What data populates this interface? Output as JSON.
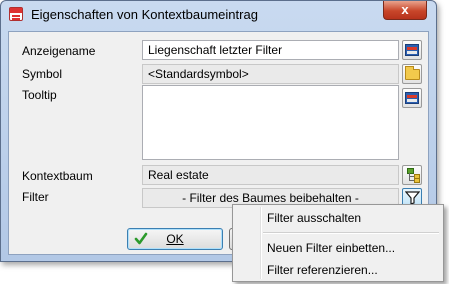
{
  "window": {
    "title": "Eigenschaften von Kontextbaumeintrag",
    "close_label": "x"
  },
  "form": {
    "anzeigename_label": "Anzeigename",
    "anzeigename_value": "Liegenschaft letzter Filter",
    "symbol_label": "Symbol",
    "symbol_value": "<Standardsymbol>",
    "tooltip_label": "Tooltip",
    "tooltip_value": "",
    "kontextbaum_label": "Kontextbaum",
    "kontextbaum_value": "Real estate",
    "filter_label": "Filter",
    "filter_value": "- Filter des Baumes beibehalten -"
  },
  "buttons": {
    "ok_label": "OK"
  },
  "context_menu": {
    "items": [
      "Filter ausschalten",
      "Neuen Filter einbetten...",
      "Filter referenzieren..."
    ]
  },
  "icons": {
    "anzeigename_button": "translation-book-icon",
    "symbol_button": "open-folder-icon",
    "tooltip_button": "translation-book-icon",
    "kontextbaum_button": "tree-icon",
    "filter_button": "funnel-filter-icon",
    "ok_icon": "checkmark-icon"
  }
}
